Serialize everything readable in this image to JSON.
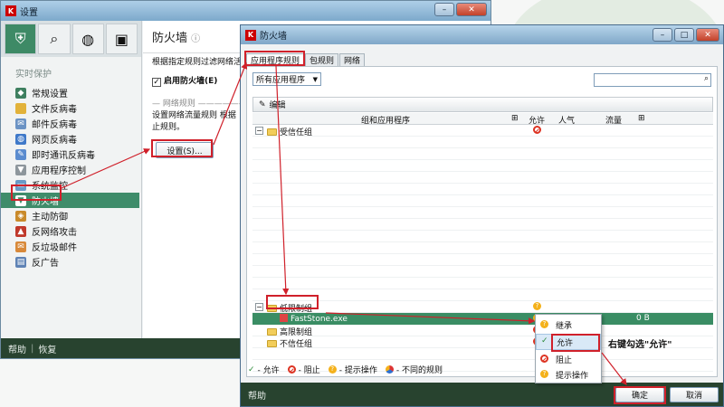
{
  "settings_window": {
    "title": "设置",
    "nav_header": "实时保护",
    "nav_items": [
      {
        "label": "常规设置",
        "icon": "shield-icon"
      },
      {
        "label": "文件反病毒",
        "icon": "folder-icon"
      },
      {
        "label": "邮件反病毒",
        "icon": "mail-icon"
      },
      {
        "label": "网页反病毒",
        "icon": "globe-icon"
      },
      {
        "label": "即时通讯反病毒",
        "icon": "chat-icon"
      },
      {
        "label": "应用程序控制",
        "icon": "filter-icon"
      },
      {
        "label": "系统监控",
        "icon": "monitor-icon"
      },
      {
        "label": "防火墙",
        "icon": "firewall-icon"
      },
      {
        "label": "主动防御",
        "icon": "defense-icon"
      },
      {
        "label": "反网络攻击",
        "icon": "network-attack-icon"
      },
      {
        "label": "反垃圾邮件",
        "icon": "spam-icon"
      },
      {
        "label": "反广告",
        "icon": "ad-block-icon"
      }
    ],
    "content_title": "防火墙",
    "content_desc": "根据指定规则过滤网络活",
    "enable_label": "启用防火墙(E)",
    "section_label": "网络规则",
    "section_desc_1": "设置网络流量规则   根据",
    "section_desc_2": "止规则。",
    "settings_button": "设置(S)...",
    "footer_help": "帮助",
    "footer_restore": "恢复"
  },
  "firewall_dialog": {
    "title": "防火墙",
    "tabs": [
      "应用程序规则",
      "包规则",
      "网络"
    ],
    "filter_select": "所有应用程序",
    "edit_label": "编辑",
    "columns": {
      "group": "组和应用程序",
      "allow": "允许",
      "popularity": "人气",
      "traffic": "流量"
    },
    "groups": [
      {
        "label": "受信任组"
      },
      {
        "label": "低限制组"
      },
      {
        "label": "高限制组"
      },
      {
        "label": "不信任组"
      }
    ],
    "selected_app": {
      "name": "FastStone.exe",
      "traffic": "0 B"
    },
    "legend": {
      "allow": "- 允许",
      "block": "- 阻止",
      "prompt": "- 提示操作",
      "mixed": "- 不同的规则"
    },
    "footer_help": "帮助",
    "ok_button": "确定",
    "cancel_button": "取消"
  },
  "context_menu": {
    "items": [
      "继承",
      "允许",
      "阻止",
      "提示操作"
    ]
  },
  "annotation": "右键勾选\"允许\"",
  "colors": {
    "accent_green": "#3f8c6a",
    "annotation_red": "#d0202a",
    "dark_bar": "#28432f"
  }
}
